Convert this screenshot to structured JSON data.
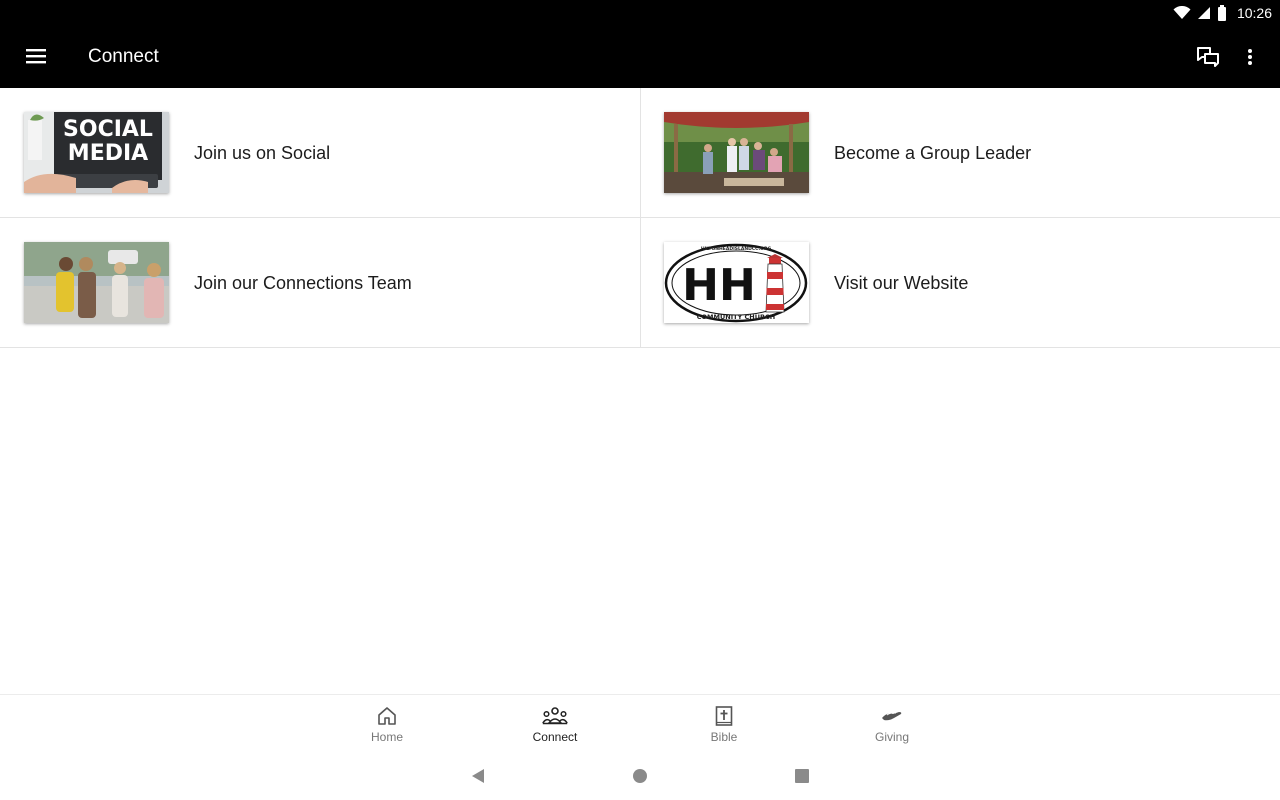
{
  "status": {
    "time": "10:26"
  },
  "appbar": {
    "title": "Connect"
  },
  "items": [
    {
      "label": "Join us on Social",
      "thumb_text_line1": "SOCIAL",
      "thumb_text_line2": "MEDIA"
    },
    {
      "label": "Become a Group Leader"
    },
    {
      "label": "Join our Connections Team"
    },
    {
      "label": "Visit our Website",
      "logo_text": "HH",
      "logo_top": "HILTONHEADISLANDCC.ORG",
      "logo_bottom": "COMMUNITY CHURCH"
    }
  ],
  "nav": [
    {
      "label": "Home",
      "icon": "home-icon"
    },
    {
      "label": "Connect",
      "icon": "people-icon",
      "active": true
    },
    {
      "label": "Bible",
      "icon": "bible-icon"
    },
    {
      "label": "Giving",
      "icon": "giving-hand-icon"
    }
  ],
  "colors": {
    "appbar": "#000000",
    "divider": "#e3e3e3",
    "active_nav": "#222222",
    "inactive_nav": "#777777"
  }
}
